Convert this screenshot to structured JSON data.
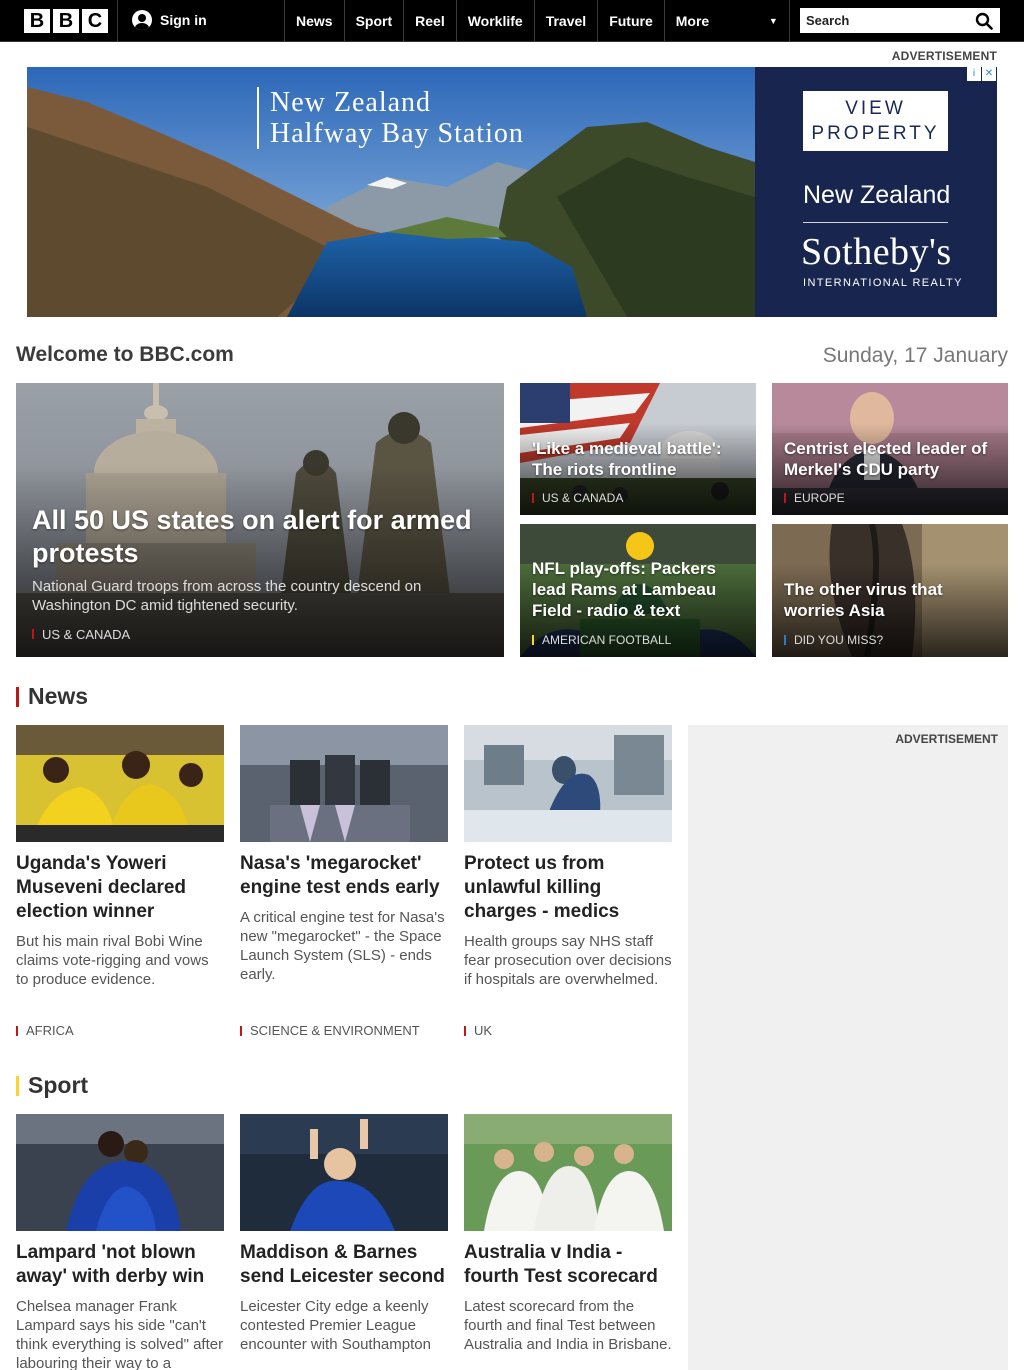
{
  "brand": {
    "letters": [
      "B",
      "B",
      "C"
    ]
  },
  "header": {
    "signin_label": "Sign in",
    "nav": [
      "News",
      "Sport",
      "Reel",
      "Worklife",
      "Travel",
      "Future"
    ],
    "more_label": "More",
    "search_placeholder": "Search"
  },
  "top_ad": {
    "label": "ADVERTISEMENT",
    "title_line1": "New Zealand",
    "title_line2": "Halfway Bay Station",
    "cta": "VIEW PROPERTY",
    "region": "New Zealand",
    "brand": "Sotheby's",
    "brand_sub": "INTERNATIONAL REALTY",
    "choices_info": "i",
    "choices_close": "✕"
  },
  "welcome": {
    "title": "Welcome to BBC.com",
    "date": "Sunday, 17 January"
  },
  "hero": {
    "headline": "All 50 US states on alert for armed protests",
    "summary": "National Guard troops from across the country descend on Washington DC amid tightened security.",
    "tag": "US & CANADA"
  },
  "top_cards": [
    {
      "headline": "'Like a medieval battle': The riots frontline",
      "tag": "US & CANADA"
    },
    {
      "headline": "Centrist elected leader of Merkel's CDU party",
      "tag": "EUROPE"
    },
    {
      "headline": "NFL play-offs: Packers lead Rams at Lambeau Field - radio & text",
      "tag": "AMERICAN FOOTBALL"
    },
    {
      "headline": "The other virus that worries Asia",
      "tag": "DID YOU MISS?"
    }
  ],
  "news": {
    "title": "News",
    "ad_label": "ADVERTISEMENT",
    "stories": [
      {
        "headline": "Uganda's Yoweri Museveni declared election winner",
        "summary": "But his main rival Bobi Wine claims vote-rigging and vows to produce evidence.",
        "tag": "AFRICA"
      },
      {
        "headline": "Nasa's 'megarocket' engine test ends early",
        "summary": "A critical engine test for Nasa's new \"megarocket\" - the Space Launch System (SLS) - ends early.",
        "tag": "SCIENCE & ENVIRONMENT"
      },
      {
        "headline": "Protect us from unlawful killing charges - medics",
        "summary": "Health groups say NHS staff fear prosecution over decisions if hospitals are overwhelmed.",
        "tag": "UK"
      }
    ]
  },
  "sport": {
    "title": "Sport",
    "stories": [
      {
        "headline": "Lampard 'not blown away' with derby win",
        "summary": "Chelsea manager Frank Lampard says his side \"can't think everything is solved\" after labouring their way to a"
      },
      {
        "headline": "Maddison & Barnes send Leicester second",
        "summary": "Leicester City edge a keenly contested Premier League encounter with Southampton"
      },
      {
        "headline": "Australia v India - fourth Test scorecard",
        "summary": "Latest scorecard from the fourth and final Test between Australia and India in Brisbane."
      }
    ]
  },
  "colors": {
    "news_accent": "#bb1919",
    "sport_accent": "#ffd230",
    "culture_accent": "#2e7dc1",
    "sport_tag_accent": "#ffd230"
  }
}
